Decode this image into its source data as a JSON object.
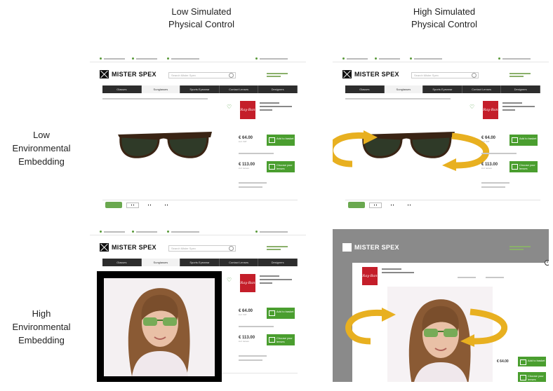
{
  "columns": {
    "low_physical": "Low Simulated\nPhysical Control",
    "high_physical": "High Simulated\nPhysical Control"
  },
  "rows": {
    "low_env": "Low\nEnvironmental\nEmbedding",
    "high_env": "High\nEnvironmental\nEmbedding"
  },
  "shop": {
    "logo": "MISTER SPEX",
    "nav": [
      "Glasses",
      "Sunglasses",
      "Sports Eyewear",
      "Contact Lenses",
      "Designers"
    ],
    "search_placeholder": "Search Mister Spex",
    "brand": "Ray-Ban",
    "price_1": "€ 64.00",
    "price_2": "€ 113.00",
    "btn_1": "Add to basket",
    "btn_2": "Choose your lenses"
  },
  "colors": {
    "arrow": "#e8b020",
    "cta": "#4a9e2f",
    "brand": "#c41e2a",
    "nav": "#2d2d2d"
  },
  "icons": [
    "rotate-arrow-left-icon",
    "rotate-arrow-right-icon",
    "heart-icon",
    "cart-icon",
    "search-icon",
    "close-icon"
  ]
}
